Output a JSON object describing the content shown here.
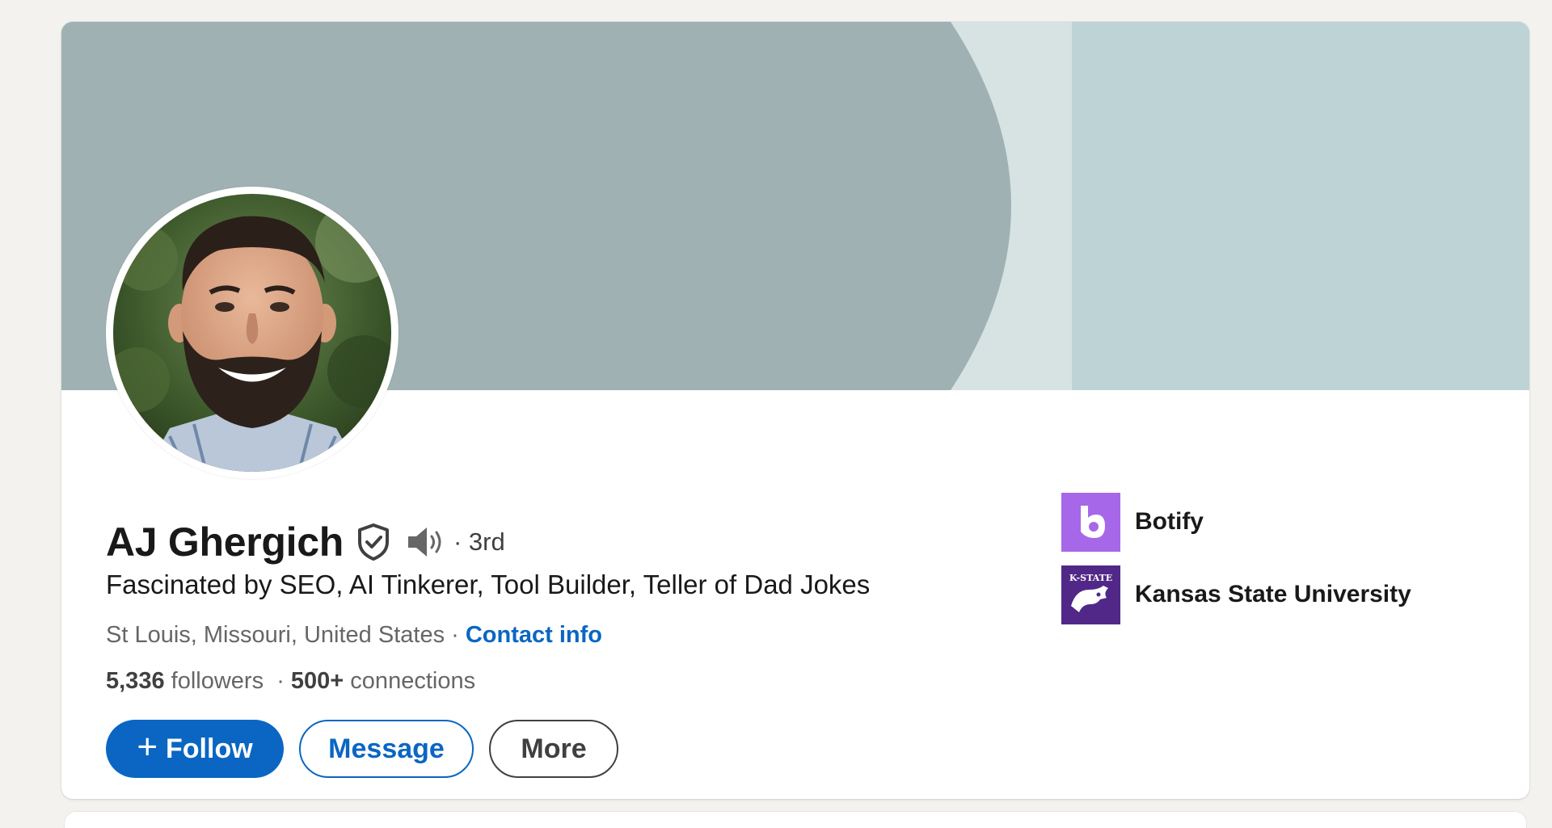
{
  "profile": {
    "name": "AJ Ghergich",
    "degree": "· 3rd",
    "headline": "Fascinated by SEO, AI Tinkerer, Tool Builder, Teller of Dad Jokes",
    "location": "St Louis, Missouri, United States",
    "location_separator": " · ",
    "contact_label": "Contact info",
    "followers_count": "5,336",
    "followers_label": " followers",
    "stats_separator": "  · ",
    "connections_count": "500+",
    "connections_label": " connections"
  },
  "actions": {
    "follow_plus": "+",
    "follow_label": "Follow",
    "message_label": "Message",
    "more_label": "More"
  },
  "orgs": [
    {
      "name": "Botify",
      "logo_icon": "botify-logo"
    },
    {
      "name": "Kansas State University",
      "logo_icon": "kstate-logo",
      "logo_text": "K-STATE"
    }
  ],
  "colors": {
    "page_bg": "#f3f2ef",
    "banner_dark": "#9fb1b3",
    "banner_mid": "#d6e3e2",
    "banner_light": "#bed3d6",
    "brand_blue": "#0a66c2",
    "botify_purple": "#a668e8",
    "kstate_purple": "#512888"
  },
  "icons": {
    "verified": "verified-shield-icon",
    "pronunciation": "speaker-icon",
    "avatar": "profile-photo"
  }
}
